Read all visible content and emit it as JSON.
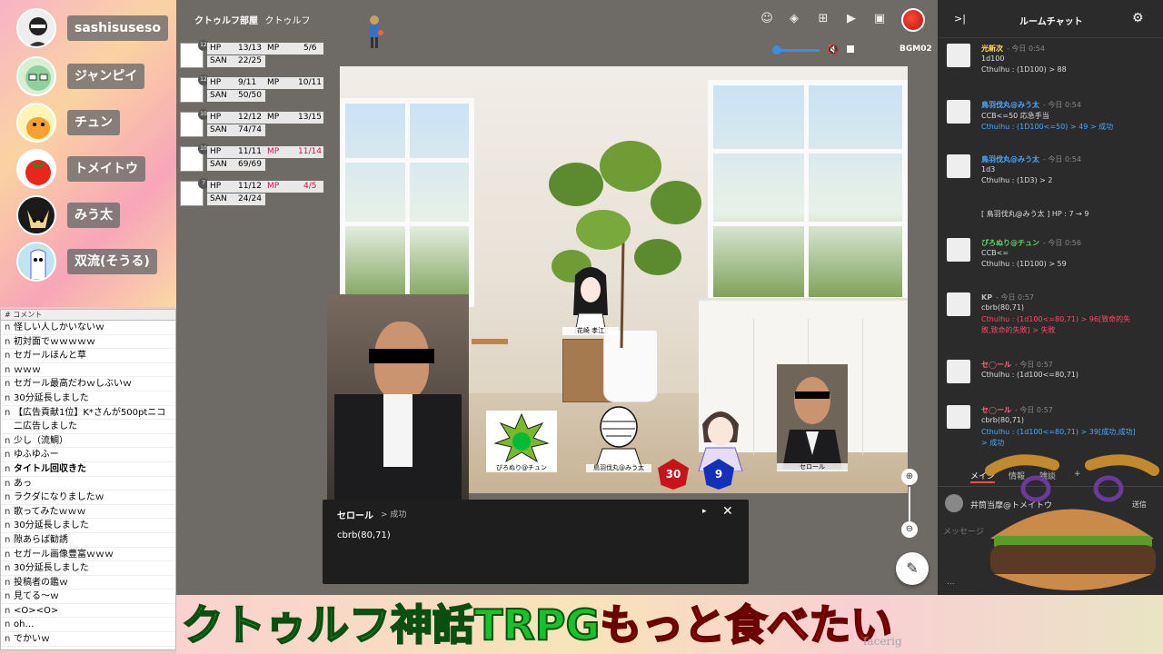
{
  "participants": [
    {
      "name": "sashisuseso",
      "color": "#dcdcdc"
    },
    {
      "name": "ジャンピイ",
      "color": "#8fd19e"
    },
    {
      "name": "チュン",
      "color": "#f9c22e"
    },
    {
      "name": "トメイトウ",
      "color": "#e8261b"
    },
    {
      "name": "みう太",
      "color": "#1a1a1a"
    },
    {
      "name": "双流(そうる)",
      "color": "#7dc6d8"
    }
  ],
  "comments": {
    "header": "# コメント",
    "rows": [
      {
        "id": "n",
        "text": "怪しい人しかいないｗ"
      },
      {
        "id": "n",
        "text": "初対面でｗｗｗｗｗ"
      },
      {
        "id": "n",
        "text": "セガールほんと草"
      },
      {
        "id": "n",
        "text": "ｗｗｗ"
      },
      {
        "id": "n",
        "text": "セガール最高だわｗしぶいｗ"
      },
      {
        "id": "n",
        "text": "30分延長しました"
      },
      {
        "id": "n",
        "text": "【広告貢献1位】K*さんが500ptニコ"
      },
      {
        "id": "",
        "text": "二広告しました"
      },
      {
        "id": "n",
        "text": "少し（流鯛）"
      },
      {
        "id": "n",
        "text": "ゆふゆふー"
      },
      {
        "id": "n",
        "text": "タイトル回収きた"
      },
      {
        "id": "n",
        "text": "あっ"
      },
      {
        "id": "n",
        "text": "ラクダになりましたｗ"
      },
      {
        "id": "n",
        "text": "歌ってみたｗｗｗ"
      },
      {
        "id": "n",
        "text": "30分延長しました"
      },
      {
        "id": "n",
        "text": "隙あらば勧誘"
      },
      {
        "id": "n",
        "text": "セガール画像豊富ｗｗｗ"
      },
      {
        "id": "n",
        "text": "30分延長しました"
      },
      {
        "id": "n",
        "text": "投稿者の鑑ｗ"
      },
      {
        "id": "n",
        "text": "見てる～ｗ"
      },
      {
        "id": "n",
        "text": "<O><O>"
      },
      {
        "id": "n",
        "text": "oh…"
      },
      {
        "id": "n",
        "text": "でかいｗ"
      }
    ]
  },
  "room": {
    "title": "クトゥルフ部屋",
    "subtitle": "クトゥルフ",
    "kp_label": "KP",
    "bgm_volume": "(volume)",
    "bgm_name": "BGM02"
  },
  "statuses": [
    {
      "level": "12",
      "hp": "13/13",
      "mp": "5/6",
      "san": "22/25"
    },
    {
      "level": "12",
      "hp": "9/11",
      "mp": "10/11",
      "san": "50/50"
    },
    {
      "level": "10",
      "hp": "12/12",
      "mp": "13/15",
      "san": "74/74"
    },
    {
      "level": "10",
      "hp": "11/11",
      "mp": "11/14",
      "san": "69/69"
    },
    {
      "level": "7",
      "hp": "11/12",
      "mp": "4/5",
      "san": "24/24"
    }
  ],
  "labels": {
    "hp": "HP",
    "mp": "MP",
    "san": "SAN"
  },
  "tokens": {
    "t1": "花崎 孝江",
    "t2": "ぴろぬり@チュン",
    "t3": "鳥羽伐丸@みう太",
    "t4": "セロール",
    "d1": "30",
    "d2": "9"
  },
  "popup": {
    "name": "セロール",
    "result": "> 成功",
    "text": "cbrb(80,71)",
    "next": "▸",
    "close": "✕"
  },
  "chat": {
    "title": "ルームチャット",
    "collapse": ">|",
    "messages": [
      {
        "name": "光新次",
        "name_color": "#ffe14a",
        "time": "- 今日 0:54",
        "lines": [
          "1d100",
          "Cthulhu : (1D100) > 88"
        ],
        "line_colors": [
          "#ddd",
          "#ddd"
        ]
      },
      {
        "name": "鳥羽伐丸@みう太",
        "name_color": "#4aa8ff",
        "time": "- 今日 0:54",
        "lines": [
          "CCB<=50 応急手当",
          "Cthulhu : (1D100<=50) > 49 > 成功"
        ],
        "line_colors": [
          "#ddd",
          "#4aa8ff"
        ]
      },
      {
        "name": "鳥羽伐丸@みう太",
        "name_color": "#4aa8ff",
        "time": "- 今日 0:54",
        "lines": [
          "1d3",
          "Cthulhu : (1D3) > 2"
        ],
        "line_colors": [
          "#ddd",
          "#ddd"
        ]
      },
      {
        "name": "",
        "name_color": "#ddd",
        "time": "",
        "lines": [
          "[ 鳥羽伐丸@みう太 ] HP : 7 → 9"
        ],
        "line_colors": [
          "#ddd"
        ]
      },
      {
        "name": "ぴろぬり@チュン",
        "name_color": "#62d16a",
        "time": "- 今日 0:56",
        "lines": [
          "CCB<=",
          "Cthulhu : (1D100) > 59"
        ],
        "line_colors": [
          "#ddd",
          "#ddd"
        ]
      },
      {
        "name": "KP",
        "name_color": "#bbb",
        "time": "- 今日 0:57",
        "lines": [
          "cbrb(80,71)",
          "Cthulhu : (1d100<=80,71) > 96[致命的失",
          "敗,致命的失敗] > 失敗"
        ],
        "line_colors": [
          "#ddd",
          "#ff4a6a",
          "#ff4a6a"
        ]
      },
      {
        "name": "セ◯ール",
        "name_color": "#ff6a7a",
        "time": "- 今日 0:57",
        "lines": [
          "Cthulhu : (1d100<=80,71)"
        ],
        "line_colors": [
          "#ddd"
        ]
      },
      {
        "name": "セ◯ール",
        "name_color": "#ff6a7a",
        "time": "- 今日 0:57",
        "lines": [
          "cbrb(80,71)",
          "Cthulhu : (1d100<=80,71) > 39[成功,成功]",
          "> 成功"
        ],
        "line_colors": [
          "#ddd",
          "#4aa8ff",
          "#4aa8ff"
        ]
      }
    ],
    "tabs": [
      "メイン",
      "情報",
      "雑談",
      "+"
    ],
    "input_name": "井筒当摩@トメイトウ",
    "send": "送信",
    "placeholder": "メッセージ",
    "more": "..."
  },
  "banner": {
    "main": "クトゥルフ神話TRPG",
    "accent": "もっと食べたい",
    "logo": "facerig"
  }
}
